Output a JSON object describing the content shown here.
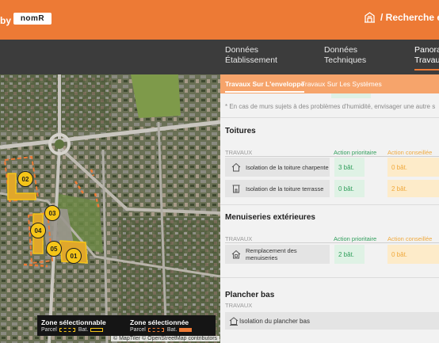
{
  "header": {
    "brand_prefix": "by",
    "logo_text": "nomR",
    "home_icon": "building-icon",
    "title": "/ Recherche éta",
    "accent": "#ed7a35"
  },
  "nav": {
    "items": [
      {
        "label": "Données\nÉtablissement"
      },
      {
        "label": "Données\nTechniques"
      },
      {
        "label": "Panorama\nTravaux"
      }
    ]
  },
  "map": {
    "markers": [
      "01",
      "02",
      "03",
      "04",
      "05"
    ],
    "legend": {
      "zone_selectable_title": "Zone sélectionnable",
      "zone_selected_title": "Zone sélectionnée",
      "parcel_label": "Parcel",
      "bat_label": "Bat."
    },
    "attribution": "© MapTiler © OpenStreetMap contributors"
  },
  "subtabs": [
    {
      "label": "Travaux Sur L'enveloppe"
    },
    {
      "label": "Travaux Sur Les Systèmes"
    }
  ],
  "note": "* En cas de murs sujets à des problèmes d'humidité, envisager une autre s",
  "columns": {
    "travaux": "TRAVAUX",
    "priority": "Action prioritaire",
    "advised": "Action conseillée"
  },
  "sections": {
    "toitures": {
      "title": "Toitures",
      "rows": [
        {
          "label": "Isolation de la toiture charpente",
          "priority": "3 bât.",
          "advised": "0 bât."
        },
        {
          "label": "Isolation de la toiture terrasse",
          "priority": "0 bât.",
          "advised": "2 bât."
        }
      ]
    },
    "menuiseries": {
      "title": "Menuiseries extérieures",
      "rows": [
        {
          "label": "Remplacement des menuiseries",
          "priority": "2 bât.",
          "advised": "0 bât."
        }
      ]
    },
    "plancher": {
      "title": "Plancher bas",
      "rows": [
        {
          "label": "Isolation du plancher bas"
        }
      ]
    }
  },
  "colors": {
    "priority_text": "#2f9e5b",
    "priority_bg": "#dff2e5",
    "advised_text": "#f0a93c",
    "advised_bg": "#fdebc9",
    "nav_bg": "#3c3c3c"
  }
}
